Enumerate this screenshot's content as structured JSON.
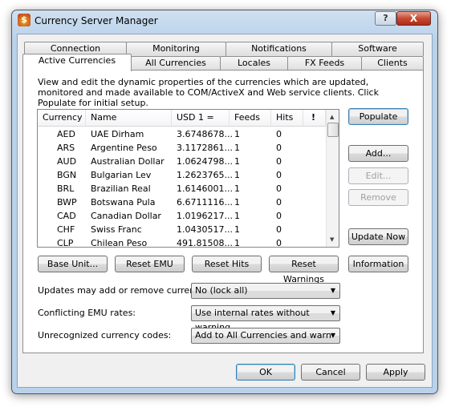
{
  "window": {
    "title": "Currency Server Manager",
    "help": "?",
    "close": "X"
  },
  "tabs_row1": [
    "Connection",
    "Monitoring",
    "Notifications",
    "Software"
  ],
  "tabs_row2": [
    "Active Currencies",
    "All Currencies",
    "Locales",
    "FX Feeds",
    "Clients"
  ],
  "selected_tab": "Active Currencies",
  "description": "View and edit the dynamic properties of the currencies which are updated, monitored and made available to COM/ActiveX and Web service clients. Click Populate for initial setup.",
  "table": {
    "columns": [
      "Currency",
      "Name",
      "USD 1 =",
      "Feeds",
      "Hits",
      "!"
    ],
    "rows": [
      [
        "AED",
        "UAE Dirham",
        "3.6748678...",
        "1",
        "0"
      ],
      [
        "ARS",
        "Argentine Peso",
        "3.1172861...",
        "1",
        "0"
      ],
      [
        "AUD",
        "Australian Dollar",
        "1.0624798...",
        "1",
        "0"
      ],
      [
        "BGN",
        "Bulgarian Lev",
        "1.2623765...",
        "1",
        "0"
      ],
      [
        "BRL",
        "Brazilian Real",
        "1.6146001...",
        "1",
        "0"
      ],
      [
        "BWP",
        "Botswana Pula",
        "6.6711116...",
        "1",
        "0"
      ],
      [
        "CAD",
        "Canadian Dollar",
        "1.0196217...",
        "1",
        "0"
      ],
      [
        "CHF",
        "Swiss Franc",
        "1.0430517...",
        "1",
        "0"
      ],
      [
        "CLP",
        "Chilean Peso",
        "491.81508...",
        "1",
        "0"
      ]
    ]
  },
  "side_buttons": {
    "populate": "Populate",
    "add": "Add...",
    "edit": "Edit...",
    "remove": "Remove",
    "update_now": "Update Now",
    "information": "Information"
  },
  "row_buttons": {
    "base_unit": "Base Unit...",
    "reset_emu": "Reset EMU",
    "reset_hits": "Reset Hits",
    "reset_warnings": "Reset Warnings"
  },
  "options": [
    {
      "label": "Updates may add or remove currencies:",
      "value": "No (lock all)"
    },
    {
      "label": "Conflicting EMU rates:",
      "value": "Use internal rates without warning"
    },
    {
      "label": "Unrecognized currency codes:",
      "value": "Add to All Currencies and warn"
    }
  ],
  "dialog_buttons": {
    "ok": "OK",
    "cancel": "Cancel",
    "apply": "Apply"
  }
}
